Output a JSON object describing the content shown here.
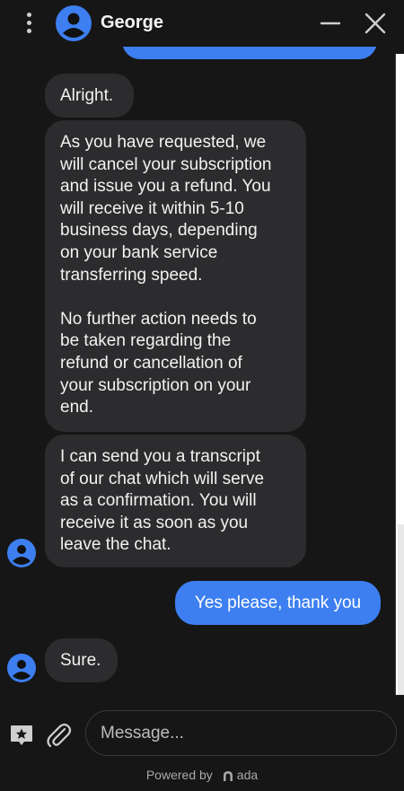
{
  "header": {
    "agent_name": "George",
    "menu_icon": "vertical-dots-icon",
    "minimize_icon": "minimize-icon",
    "close_icon": "close-icon"
  },
  "messages": [
    {
      "sender": "agent",
      "text": "Alright."
    },
    {
      "sender": "agent",
      "text": "As you have requested, we\nwill cancel your subscription\nand issue you a refund. You\nwill receive it within 5-10\nbusiness days, depending\non your bank service\ntransferring speed.\n\nNo further action needs to\nbe taken regarding the\nrefund or cancellation of\nyour subscription on your\nend."
    },
    {
      "sender": "agent",
      "text": "I can send you a transcript\nof our chat which will serve\nas a confirmation. You will\nreceive it as soon as you\nleave the chat."
    },
    {
      "sender": "user",
      "text": "Yes please, thank you"
    },
    {
      "sender": "agent",
      "text": "Sure."
    }
  ],
  "composer": {
    "placeholder": "Message...",
    "star_icon": "star-bubble-icon",
    "attach_icon": "paperclip-icon"
  },
  "footer": {
    "powered_by": "Powered by",
    "brand": "ada"
  },
  "colors": {
    "background": "#161616",
    "agent_bubble": "#2c2c2e",
    "user_bubble": "#3d7ff0",
    "avatar": "#3d7ff0"
  }
}
